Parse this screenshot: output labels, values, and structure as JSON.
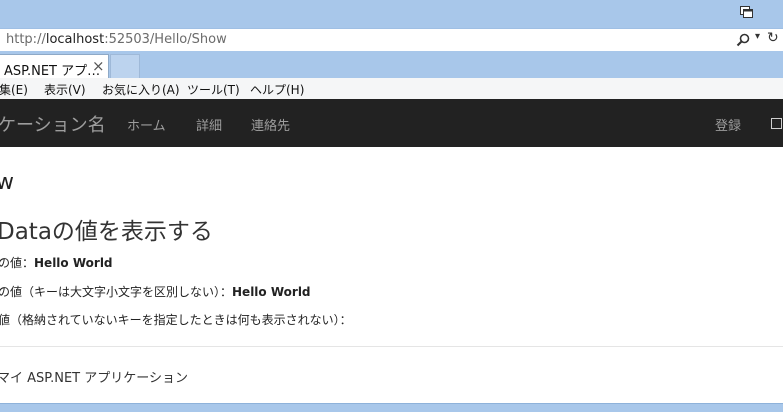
{
  "browser": {
    "address_prefix": "http://",
    "address_host": "localhost",
    "address_path": ":52503/Hello/Show",
    "tab_title": "ASP.NET アプ…",
    "tab_close": "×",
    "dropdown_glyph": "▾",
    "refresh_glyph": "↻"
  },
  "menubar": {
    "items": [
      "集(E)",
      "表示(V)",
      "お気に入り(A)",
      "ツール(T)",
      "ヘルプ(H)"
    ]
  },
  "navbar": {
    "brand": "ケーション名",
    "links": [
      "ホーム",
      "詳細",
      "連絡先"
    ],
    "register": "登録"
  },
  "content": {
    "heading": "w",
    "subheading": "Dataの値を表示する",
    "line1_label": "の値：",
    "line1_value": "Hello World",
    "line2_label": "の値（キーは大文字小文字を区別しない）：",
    "line2_value": "Hello World",
    "line3_label": "値（格納されていないキーを指定したときは何も表示されない）：",
    "footer": "マイ ASP.NET アプリケーション"
  },
  "colors": {
    "chrome": "#a8c7ea",
    "navbar": "#222222",
    "nav_text": "#9d9d9d"
  }
}
